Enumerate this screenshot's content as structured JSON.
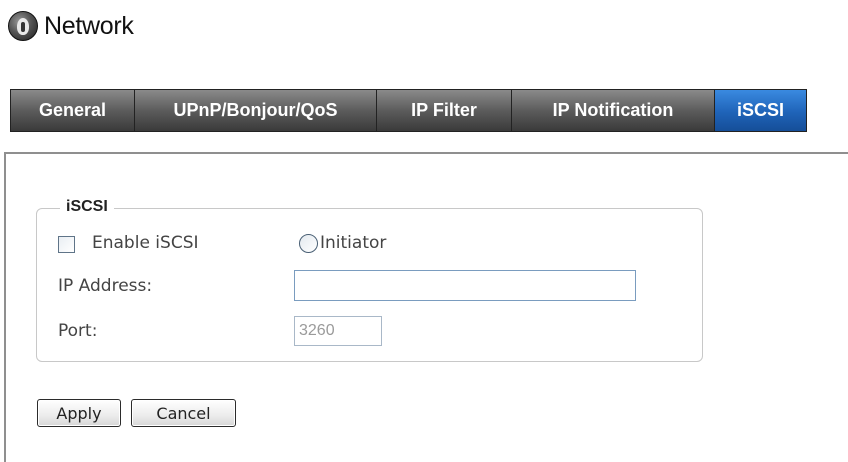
{
  "page": {
    "title": "Network",
    "icon": "network-globe-icon"
  },
  "tabs": [
    {
      "label": "General",
      "active": false
    },
    {
      "label": "UPnP/Bonjour/QoS",
      "active": false
    },
    {
      "label": "IP Filter",
      "active": false
    },
    {
      "label": "IP Notification",
      "active": false
    },
    {
      "label": "iSCSI",
      "active": true
    }
  ],
  "iscsi": {
    "legend": "iSCSI",
    "enable_label": "Enable iSCSI",
    "enable_checked": false,
    "initiator_label": "Initiator",
    "initiator_selected": false,
    "ip_address_label": "IP Address:",
    "ip_address_value": "",
    "port_label": "Port:",
    "port_value": "3260"
  },
  "actions": {
    "apply_label": "Apply",
    "cancel_label": "Cancel"
  },
  "colors": {
    "tab_active": "#1f63b8",
    "tab_bar": "#4a4a4a",
    "panel_border": "#8f8f8f"
  }
}
